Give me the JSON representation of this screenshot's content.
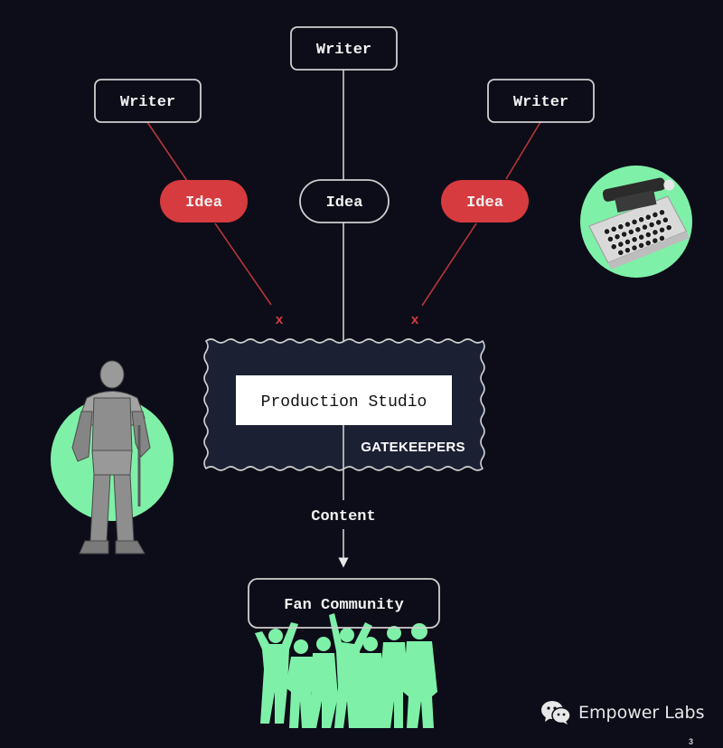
{
  "diagram": {
    "writers": [
      {
        "label": "Writer"
      },
      {
        "label": "Writer"
      },
      {
        "label": "Writer"
      }
    ],
    "ideas": [
      {
        "label": "Idea",
        "status": "rejected"
      },
      {
        "label": "Idea",
        "status": "accepted"
      },
      {
        "label": "Idea",
        "status": "rejected"
      }
    ],
    "rejected_marks": [
      "x",
      "x"
    ],
    "studio": {
      "label": "Production Studio",
      "group_label": "GATEKEEPERS"
    },
    "output_label": "Content",
    "audience": {
      "label": "Fan Community"
    },
    "illustrations": [
      {
        "name": "typewriter",
        "description": "typewriter-image"
      },
      {
        "name": "knight",
        "description": "knight-armor-image"
      },
      {
        "name": "crowd",
        "description": "crowd-silhouette-image"
      }
    ]
  },
  "colors": {
    "background": "#0c0d18",
    "rejected_idea": "#d63b3f",
    "rejected_line": "#b83538",
    "accent_green": "#7ff0a8",
    "outline": "#cfcfcf",
    "text": "#f2f2f2"
  },
  "footer": {
    "brand_icon": "wechat-icon",
    "brand_name": "Empower Labs",
    "page_number": "3"
  }
}
